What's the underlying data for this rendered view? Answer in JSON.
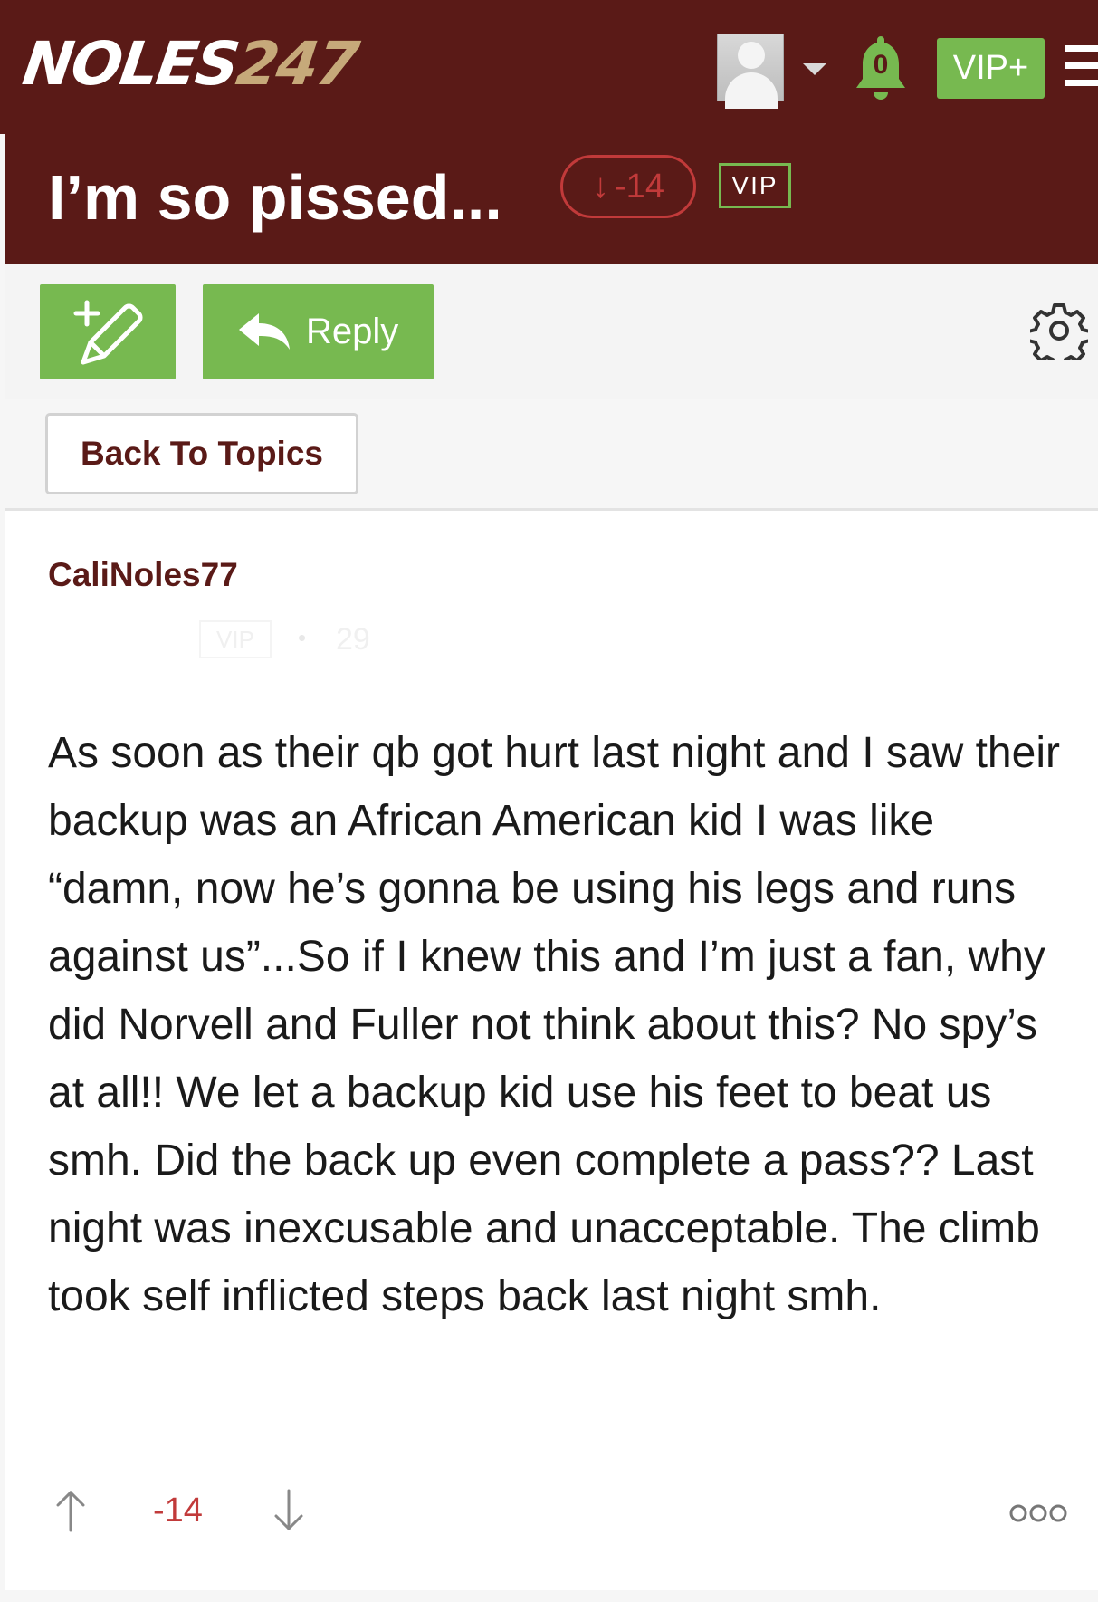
{
  "header": {
    "logo_primary": "NOLES",
    "logo_number": "247",
    "notification_count": "0",
    "vip_plus_label": "VIP+"
  },
  "topic": {
    "title": "I’m so pissed...",
    "score": "-14",
    "badge": "VIP"
  },
  "actions": {
    "reply_label": "Reply",
    "back_label": "Back To Topics"
  },
  "post": {
    "author": "CaliNoles77",
    "author_badge": "VIP",
    "author_post_count": "29",
    "body": "As soon as their qb got hurt last night and I saw their backup was an African American kid I was like “damn, now he’s gonna be using his legs and runs against us”...So if I knew this and I’m just a fan, why did Norvell and Fuller not think about this? No spy’s at all!! We let a backup kid use his feet to beat us smh. Did the back up even complete a pass?? Last night was inexcusable and unacceptable. The climb took self inflicted steps back last night smh.",
    "score": "-14"
  },
  "colors": {
    "garnet": "#5a1a17",
    "gold": "#c6a97a",
    "green": "#77b950",
    "negative": "#c13a3a"
  },
  "icons": [
    "user-avatar",
    "chevron-down-icon",
    "bell-icon",
    "hamburger-icon",
    "new-topic-icon",
    "reply-arrow-icon",
    "gear-icon",
    "arrow-up-icon",
    "arrow-down-icon",
    "more-options-icon"
  ]
}
